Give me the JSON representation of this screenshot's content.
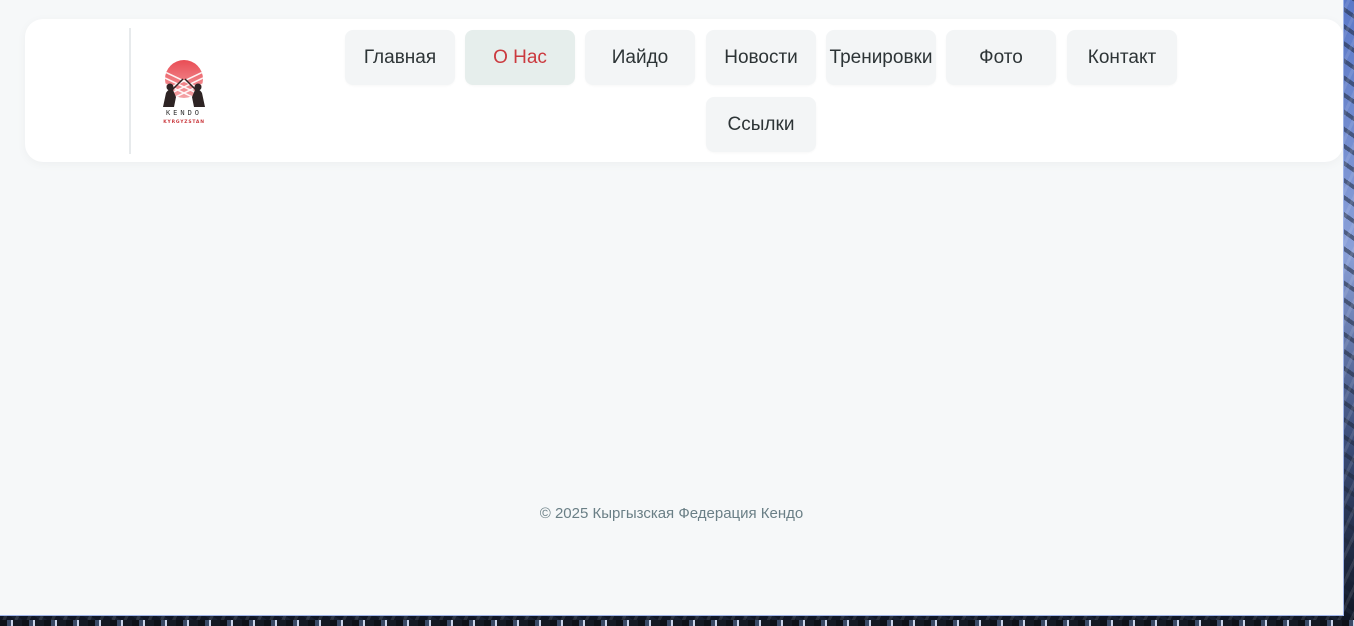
{
  "brand": {
    "logo_text": "KENDO",
    "logo_subtext": "KYRGYZSTAN",
    "accent_color": "#cb3a3f"
  },
  "nav": {
    "items": [
      {
        "label": "Главная",
        "active": false
      },
      {
        "label": "О Нас",
        "active": true
      },
      {
        "label": "Иайдо",
        "active": false
      },
      {
        "label": "Новости",
        "active": false
      },
      {
        "label": "Тренировки",
        "active": false
      },
      {
        "label": "Фото",
        "active": false
      },
      {
        "label": "Контакт",
        "active": false
      },
      {
        "label": "Ссылки",
        "active": false
      }
    ]
  },
  "footer": {
    "copyright": "© 2025 Кыргызская Федерация Кендо"
  }
}
